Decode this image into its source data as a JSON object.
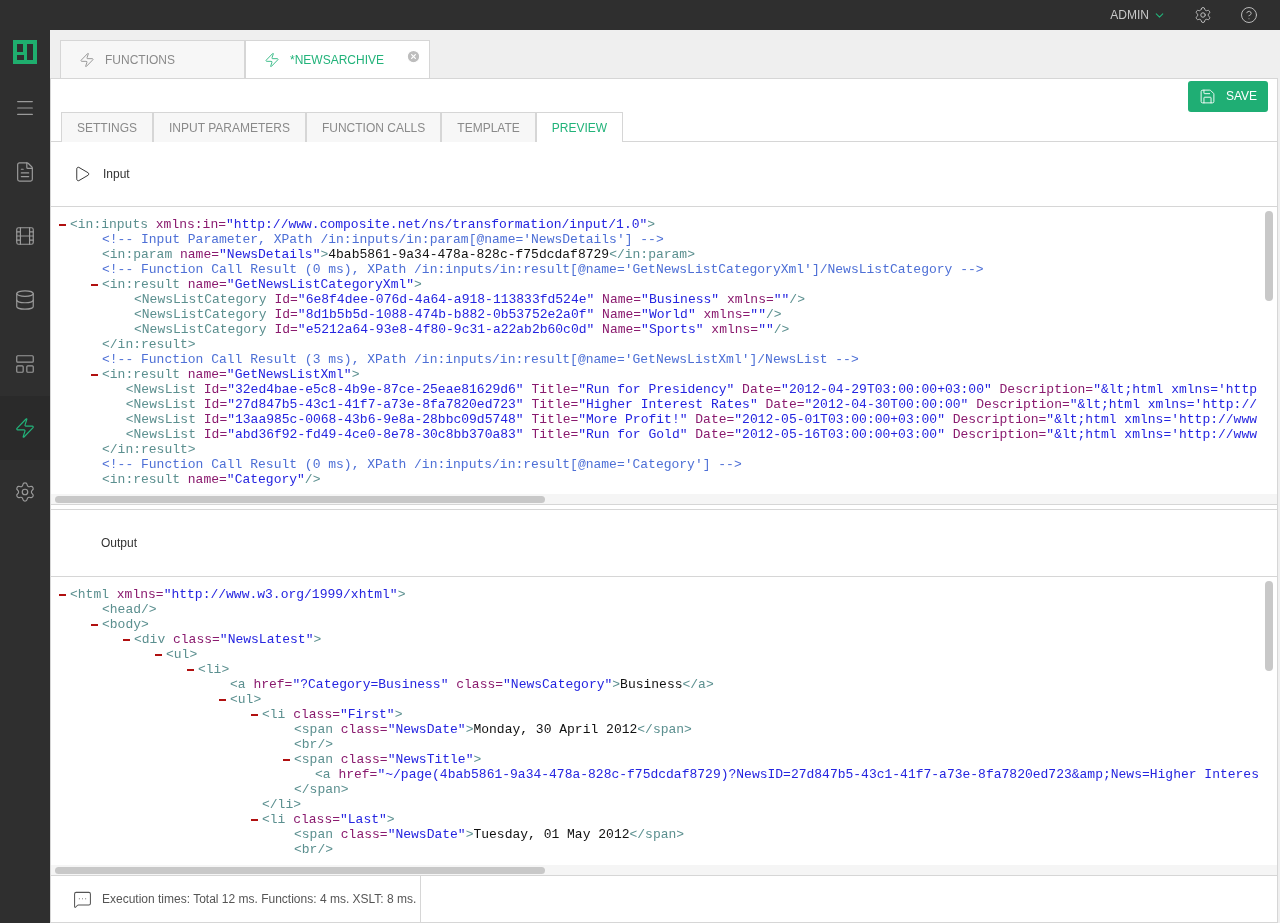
{
  "top_bar": {
    "user": "ADMIN"
  },
  "sidebar": {
    "items": [
      {
        "kind": "menu",
        "selected": false
      },
      {
        "kind": "file",
        "selected": false
      },
      {
        "kind": "film",
        "selected": false
      },
      {
        "kind": "database",
        "selected": false
      },
      {
        "kind": "layout",
        "selected": false
      },
      {
        "kind": "bolt",
        "selected": true
      },
      {
        "kind": "gear",
        "selected": false
      }
    ]
  },
  "document_tabs": [
    {
      "label": "FUNCTIONS",
      "selected": false,
      "closable": false
    },
    {
      "label": "*NEWSARCHIVE",
      "selected": true,
      "closable": true
    }
  ],
  "sub_tabs": [
    {
      "label": "SETTINGS",
      "selected": false
    },
    {
      "label": "INPUT PARAMETERS",
      "selected": false
    },
    {
      "label": "FUNCTION CALLS",
      "selected": false
    },
    {
      "label": "TEMPLATE",
      "selected": false
    },
    {
      "label": "PREVIEW",
      "selected": true
    }
  ],
  "save_button": "SAVE",
  "input": {
    "title": "Input",
    "lines": [
      {
        "tokens": [
          {
            "kind": "tag",
            "text": "<in:inputs"
          },
          {
            "kind": "attr",
            "text": " xmlns:in="
          },
          {
            "kind": "value",
            "text": "\"http://www.composite.net/ns/transformation/input/1.0\""
          },
          {
            "kind": "tag",
            "text": ">"
          }
        ],
        "expanded": true,
        "children": [
          {
            "tokens": [
              {
                "kind": "comment",
                "text": "<!-- Input Parameter, XPath /in:inputs/in:param[@name='NewsDetails'] -->"
              }
            ]
          },
          {
            "tokens": [
              {
                "kind": "tag",
                "text": "<in:param"
              },
              {
                "kind": "attr",
                "text": " name="
              },
              {
                "kind": "value",
                "text": "\"NewsDetails\""
              },
              {
                "kind": "tag",
                "text": ">"
              },
              {
                "kind": "text",
                "text": "4bab5861-9a34-478a-828c-f75dcdaf8729"
              },
              {
                "kind": "tag",
                "text": "</in:param>"
              }
            ]
          },
          {
            "tokens": [
              {
                "kind": "comment",
                "text": "<!-- Function Call Result (0 ms), XPath /in:inputs/in:result[@name='GetNewsListCategoryXml']/NewsListCategory -->"
              }
            ]
          },
          {
            "tokens": [
              {
                "kind": "tag",
                "text": "<in:result"
              },
              {
                "kind": "attr",
                "text": " name="
              },
              {
                "kind": "value",
                "text": "\"GetNewsListCategoryXml\""
              },
              {
                "kind": "tag",
                "text": ">"
              }
            ],
            "expanded": true,
            "children": [
              {
                "tokens": [
                  {
                    "kind": "tag",
                    "text": "<NewsListCategory"
                  },
                  {
                    "kind": "attr",
                    "text": " Id="
                  },
                  {
                    "kind": "value",
                    "text": "\"6e8f4dee-076d-4a64-a918-113833fd524e\""
                  },
                  {
                    "kind": "attr",
                    "text": " Name="
                  },
                  {
                    "kind": "value",
                    "text": "\"Business\""
                  },
                  {
                    "kind": "attr",
                    "text": " xmlns="
                  },
                  {
                    "kind": "value",
                    "text": "\"\""
                  },
                  {
                    "kind": "tag",
                    "text": "/>"
                  }
                ]
              },
              {
                "tokens": [
                  {
                    "kind": "tag",
                    "text": "<NewsListCategory"
                  },
                  {
                    "kind": "attr",
                    "text": " Id="
                  },
                  {
                    "kind": "value",
                    "text": "\"8d1b5b5d-1088-474b-b882-0b53752e2a0f\""
                  },
                  {
                    "kind": "attr",
                    "text": " Name="
                  },
                  {
                    "kind": "value",
                    "text": "\"World\""
                  },
                  {
                    "kind": "attr",
                    "text": " xmlns="
                  },
                  {
                    "kind": "value",
                    "text": "\"\""
                  },
                  {
                    "kind": "tag",
                    "text": "/>"
                  }
                ]
              },
              {
                "tokens": [
                  {
                    "kind": "tag",
                    "text": "<NewsListCategory"
                  },
                  {
                    "kind": "attr",
                    "text": " Id="
                  },
                  {
                    "kind": "value",
                    "text": "\"e5212a64-93e8-4f80-9c31-a22ab2b60c0d\""
                  },
                  {
                    "kind": "attr",
                    "text": " Name="
                  },
                  {
                    "kind": "value",
                    "text": "\"Sports\""
                  },
                  {
                    "kind": "attr",
                    "text": " xmlns="
                  },
                  {
                    "kind": "value",
                    "text": "\"\""
                  },
                  {
                    "kind": "tag",
                    "text": "/>"
                  }
                ]
              }
            ],
            "end": [
              {
                "kind": "tag",
                "text": "</in:result>"
              }
            ]
          },
          {
            "tokens": [
              {
                "kind": "comment",
                "text": "<!-- Function Call Result (3 ms), XPath /in:inputs/in:result[@name='GetNewsListXml']/NewsList -->"
              }
            ]
          },
          {
            "tokens": [
              {
                "kind": "tag",
                "text": "<in:result"
              },
              {
                "kind": "attr",
                "text": " name="
              },
              {
                "kind": "value",
                "text": "\"GetNewsListXml\""
              },
              {
                "kind": "tag",
                "text": ">"
              }
            ],
            "expanded": true,
            "children": [
              {
                "tokens": [
                  {
                    "kind": "tag",
                    "text": "<NewsList"
                  },
                  {
                    "kind": "attr",
                    "text": " Id="
                  },
                  {
                    "kind": "value",
                    "text": "\"32ed4bae-e5c8-4b9e-87ce-25eae81629d6\""
                  },
                  {
                    "kind": "attr",
                    "text": " Title="
                  },
                  {
                    "kind": "value",
                    "text": "\"Run for Presidency\""
                  },
                  {
                    "kind": "attr",
                    "text": " Date="
                  },
                  {
                    "kind": "value",
                    "text": "\"2012-04-29T03:00:00+03:00\""
                  },
                  {
                    "kind": "attr",
                    "text": " Description="
                  },
                  {
                    "kind": "value",
                    "text": "\"&lt;html xmlns='http"
                  }
                ]
              },
              {
                "tokens": [
                  {
                    "kind": "tag",
                    "text": "<NewsList"
                  },
                  {
                    "kind": "attr",
                    "text": " Id="
                  },
                  {
                    "kind": "value",
                    "text": "\"27d847b5-43c1-41f7-a73e-8fa7820ed723\""
                  },
                  {
                    "kind": "attr",
                    "text": " Title="
                  },
                  {
                    "kind": "value",
                    "text": "\"Higher Interest Rates\""
                  },
                  {
                    "kind": "attr",
                    "text": " Date="
                  },
                  {
                    "kind": "value",
                    "text": "\"2012-04-30T00:00:00\""
                  },
                  {
                    "kind": "attr",
                    "text": " Description="
                  },
                  {
                    "kind": "value",
                    "text": "\"&lt;html xmlns='http://"
                  }
                ]
              },
              {
                "tokens": [
                  {
                    "kind": "tag",
                    "text": "<NewsList"
                  },
                  {
                    "kind": "attr",
                    "text": " Id="
                  },
                  {
                    "kind": "value",
                    "text": "\"13aa985c-0068-43b6-9e8a-28bbc09d5748\""
                  },
                  {
                    "kind": "attr",
                    "text": " Title="
                  },
                  {
                    "kind": "value",
                    "text": "\"More Profit!\""
                  },
                  {
                    "kind": "attr",
                    "text": " Date="
                  },
                  {
                    "kind": "value",
                    "text": "\"2012-05-01T03:00:00+03:00\""
                  },
                  {
                    "kind": "attr",
                    "text": " Description="
                  },
                  {
                    "kind": "value",
                    "text": "\"&lt;html xmlns='http://www"
                  }
                ]
              },
              {
                "tokens": [
                  {
                    "kind": "tag",
                    "text": "<NewsList"
                  },
                  {
                    "kind": "attr",
                    "text": " Id="
                  },
                  {
                    "kind": "value",
                    "text": "\"abd36f92-fd49-4ce0-8e78-30c8bb370a83\""
                  },
                  {
                    "kind": "attr",
                    "text": " Title="
                  },
                  {
                    "kind": "value",
                    "text": "\"Run for Gold\""
                  },
                  {
                    "kind": "attr",
                    "text": " Date="
                  },
                  {
                    "kind": "value",
                    "text": "\"2012-05-16T03:00:00+03:00\""
                  },
                  {
                    "kind": "attr",
                    "text": " Description="
                  },
                  {
                    "kind": "value",
                    "text": "\"&lt;html xmlns='http://www"
                  }
                ]
              }
            ],
            "end": [
              {
                "kind": "tag",
                "text": "</in:result>"
              }
            ]
          },
          {
            "tokens": [
              {
                "kind": "comment",
                "text": "<!-- Function Call Result (0 ms), XPath /in:inputs/in:result[@name='Category'] -->"
              }
            ]
          },
          {
            "tokens": [
              {
                "kind": "tag",
                "text": "<in:result"
              },
              {
                "kind": "attr",
                "text": " name="
              },
              {
                "kind": "value",
                "text": "\"Category\""
              },
              {
                "kind": "tag",
                "text": "/>"
              }
            ]
          }
        ]
      }
    ]
  },
  "output": {
    "title": "Output",
    "lines": [
      {
        "tokens": [
          {
            "kind": "tag",
            "text": "<html"
          },
          {
            "kind": "attr",
            "text": " xmlns="
          },
          {
            "kind": "value",
            "text": "\"http://www.w3.org/1999/xhtml\""
          },
          {
            "kind": "tag",
            "text": ">"
          }
        ],
        "expanded": true,
        "children": [
          {
            "tokens": [
              {
                "kind": "tag",
                "text": "<head/>"
              }
            ]
          },
          {
            "tokens": [
              {
                "kind": "tag",
                "text": "<body>"
              }
            ],
            "expanded": true,
            "children": [
              {
                "tokens": [
                  {
                    "kind": "tag",
                    "text": "<div"
                  },
                  {
                    "kind": "attr",
                    "text": " class="
                  },
                  {
                    "kind": "value",
                    "text": "\"NewsLatest\""
                  },
                  {
                    "kind": "tag",
                    "text": ">"
                  }
                ],
                "expanded": true,
                "children": [
                  {
                    "tokens": [
                      {
                        "kind": "tag",
                        "text": "<ul>"
                      }
                    ],
                    "expanded": true,
                    "children": [
                      {
                        "tokens": [
                          {
                            "kind": "tag",
                            "text": "<li>"
                          }
                        ],
                        "expanded": true,
                        "children": [
                          {
                            "tokens": [
                              {
                                "kind": "tag",
                                "text": "<a"
                              },
                              {
                                "kind": "attr",
                                "text": " href="
                              },
                              {
                                "kind": "value",
                                "text": "\"?Category=Business\""
                              },
                              {
                                "kind": "attr",
                                "text": " class="
                              },
                              {
                                "kind": "value",
                                "text": "\"NewsCategory\""
                              },
                              {
                                "kind": "tag",
                                "text": ">"
                              },
                              {
                                "kind": "text",
                                "text": "Business"
                              },
                              {
                                "kind": "tag",
                                "text": "</a>"
                              }
                            ]
                          },
                          {
                            "tokens": [
                              {
                                "kind": "tag",
                                "text": "<ul>"
                              }
                            ],
                            "expanded": true,
                            "children": [
                              {
                                "tokens": [
                                  {
                                    "kind": "tag",
                                    "text": "<li"
                                  },
                                  {
                                    "kind": "attr",
                                    "text": " class="
                                  },
                                  {
                                    "kind": "value",
                                    "text": "\"First\""
                                  },
                                  {
                                    "kind": "tag",
                                    "text": ">"
                                  }
                                ],
                                "expanded": true,
                                "children": [
                                  {
                                    "tokens": [
                                      {
                                        "kind": "tag",
                                        "text": "<span"
                                      },
                                      {
                                        "kind": "attr",
                                        "text": " class="
                                      },
                                      {
                                        "kind": "value",
                                        "text": "\"NewsDate\""
                                      },
                                      {
                                        "kind": "tag",
                                        "text": ">"
                                      },
                                      {
                                        "kind": "text",
                                        "text": "Monday, 30 April 2012"
                                      },
                                      {
                                        "kind": "tag",
                                        "text": "</span>"
                                      }
                                    ]
                                  },
                                  {
                                    "tokens": [
                                      {
                                        "kind": "tag",
                                        "text": "<br/>"
                                      }
                                    ]
                                  },
                                  {
                                    "tokens": [
                                      {
                                        "kind": "tag",
                                        "text": "<span"
                                      },
                                      {
                                        "kind": "attr",
                                        "text": " class="
                                      },
                                      {
                                        "kind": "value",
                                        "text": "\"NewsTitle\""
                                      },
                                      {
                                        "kind": "tag",
                                        "text": ">"
                                      }
                                    ],
                                    "expanded": true,
                                    "children": [
                                      {
                                        "tokens": [
                                          {
                                            "kind": "tag",
                                            "text": "<a"
                                          },
                                          {
                                            "kind": "attr",
                                            "text": " href="
                                          },
                                          {
                                            "kind": "value",
                                            "text": "\"~/page(4bab5861-9a34-478a-828c-f75dcdaf8729)?NewsID=27d847b5-43c1-41f7-a73e-8fa7820ed723&amp;News=Higher Interes"
                                          }
                                        ]
                                      }
                                    ],
                                    "end": [
                                      {
                                        "kind": "tag",
                                        "text": "</span>"
                                      }
                                    ]
                                  }
                                ],
                                "end": [
                                  {
                                    "kind": "tag",
                                    "text": "</li>"
                                  }
                                ]
                              },
                              {
                                "tokens": [
                                  {
                                    "kind": "tag",
                                    "text": "<li"
                                  },
                                  {
                                    "kind": "attr",
                                    "text": " class="
                                  },
                                  {
                                    "kind": "value",
                                    "text": "\"Last\""
                                  },
                                  {
                                    "kind": "tag",
                                    "text": ">"
                                  }
                                ],
                                "expanded": true,
                                "children": [
                                  {
                                    "tokens": [
                                      {
                                        "kind": "tag",
                                        "text": "<span"
                                      },
                                      {
                                        "kind": "attr",
                                        "text": " class="
                                      },
                                      {
                                        "kind": "value",
                                        "text": "\"NewsDate\""
                                      },
                                      {
                                        "kind": "tag",
                                        "text": ">"
                                      },
                                      {
                                        "kind": "text",
                                        "text": "Tuesday, 01 May 2012"
                                      },
                                      {
                                        "kind": "tag",
                                        "text": "</span>"
                                      }
                                    ]
                                  },
                                  {
                                    "tokens": [
                                      {
                                        "kind": "tag",
                                        "text": "<br/>"
                                      }
                                    ]
                                  }
                                ]
                              }
                            ]
                          }
                        ]
                      }
                    ]
                  }
                ]
              }
            ]
          }
        ]
      }
    ]
  },
  "status_bar": {
    "message": "Execution times: Total 12 ms. Functions: 4 ms. XSLT: 8 ms."
  }
}
